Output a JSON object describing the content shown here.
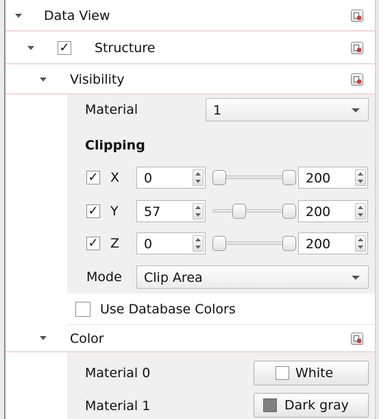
{
  "data_view": {
    "label": "Data View"
  },
  "structure": {
    "label": "Structure",
    "checked": true,
    "check_glyph": "✓"
  },
  "visibility": {
    "label": "Visibility"
  },
  "material": {
    "label": "Material",
    "selected": "1"
  },
  "clipping": {
    "title": "Clipping",
    "axes": [
      {
        "label": "X",
        "checked": true,
        "check_glyph": "✓",
        "min": "0",
        "max": "200",
        "slider_min_fraction": 0.0,
        "slider_max_fraction": 1.0
      },
      {
        "label": "Y",
        "checked": true,
        "check_glyph": "✓",
        "min": "57",
        "max": "200",
        "slider_min_fraction": 0.285,
        "slider_max_fraction": 1.0
      },
      {
        "label": "Z",
        "checked": true,
        "check_glyph": "✓",
        "min": "0",
        "max": "200",
        "slider_min_fraction": 0.0,
        "slider_max_fraction": 1.0
      }
    ],
    "mode_label": "Mode",
    "mode_value": "Clip Area"
  },
  "use_db_colors": {
    "label": "Use Database Colors",
    "checked": false
  },
  "color": {
    "label": "Color",
    "materials": [
      {
        "label": "Material 0",
        "color_name": "White",
        "swatch": "#ffffff"
      },
      {
        "label": "Material 1",
        "color_name": "Dark gray",
        "swatch": "#808080"
      }
    ]
  },
  "icons": {
    "expand": "chevron-down-icon",
    "reset": "reset-default-icon"
  }
}
